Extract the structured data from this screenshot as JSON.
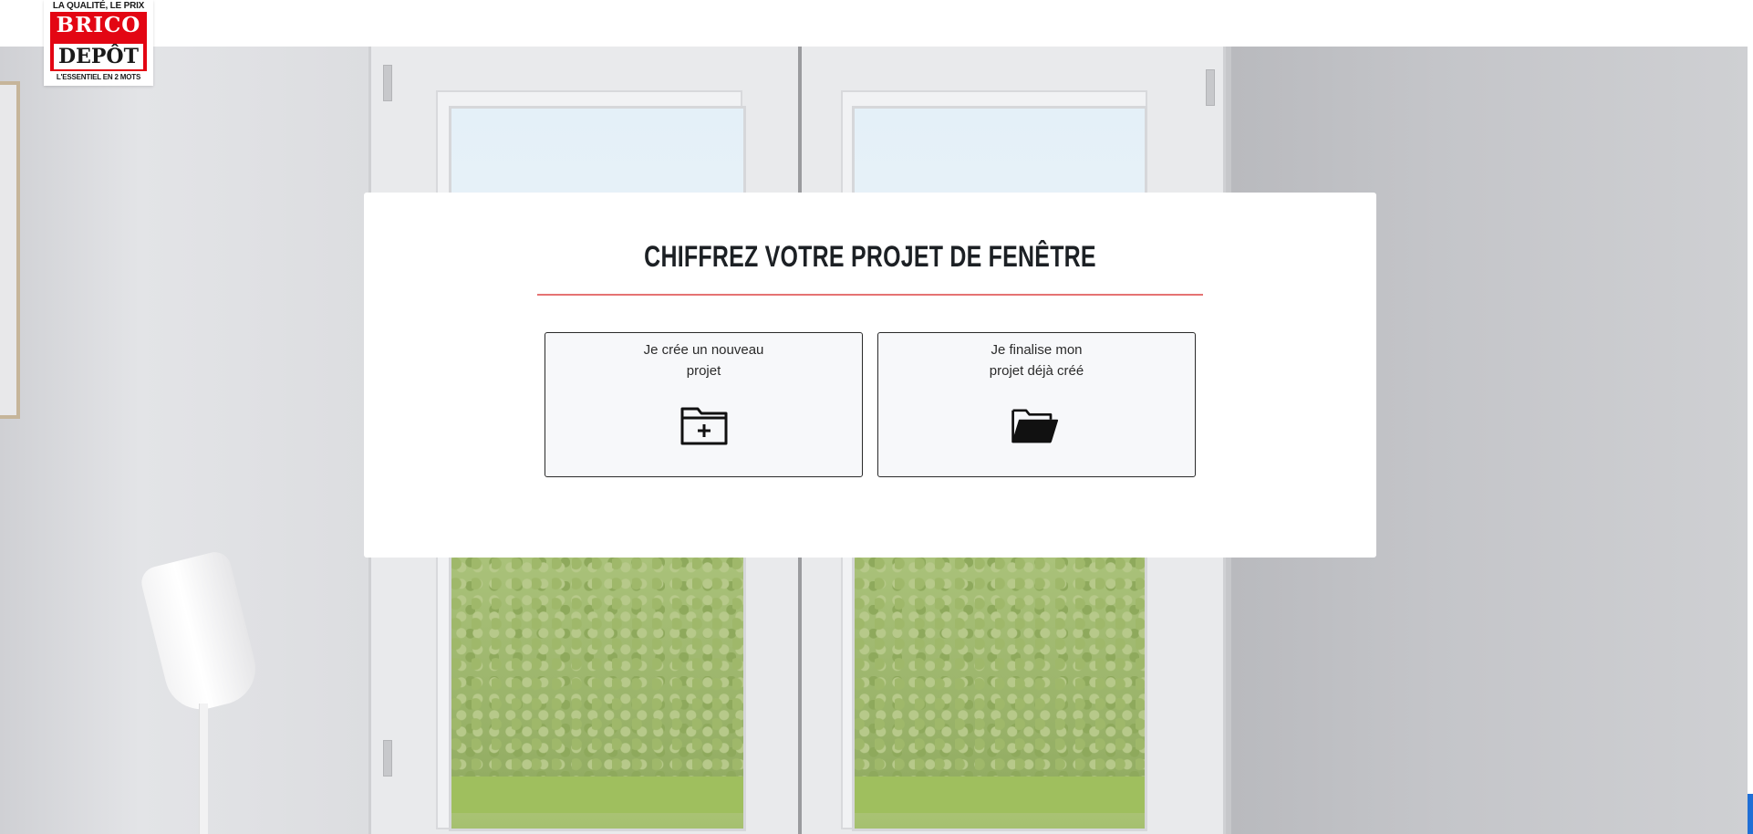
{
  "logo": {
    "tagline": "LA QUALITÉ, LE PRIX",
    "brand_top": "BRICO",
    "brand_bottom": "DEPÔT",
    "subtagline": "L'ESSENTIEL EN 2 MOTS"
  },
  "card": {
    "title": "CHIFFREZ VOTRE PROJET DE FENÊTRE",
    "options": [
      {
        "line1": "Je crée un nouveau",
        "line2": "projet",
        "icon": "folder-plus-icon"
      },
      {
        "line1": "Je finalise mon",
        "line2": "projet déjà créé",
        "icon": "folder-open-icon"
      }
    ]
  },
  "colors": {
    "brand_red": "#e30613",
    "divider": "#e57373",
    "title_text": "#1c2024"
  }
}
